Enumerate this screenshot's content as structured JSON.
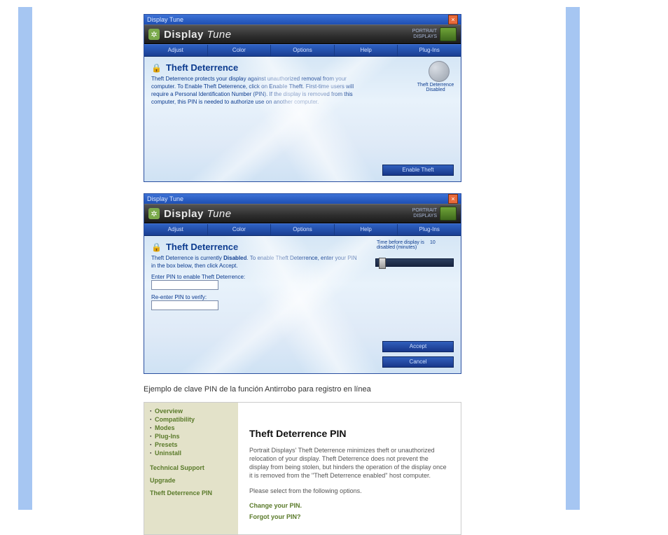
{
  "win1": {
    "titlebar": "Display Tune",
    "brand": {
      "name": "Display",
      "tune": "Tune",
      "right": "PORTRAIT\nDISPLAYS"
    },
    "tabs": [
      "Adjust",
      "Color",
      "Options",
      "Help",
      "Plug-Ins"
    ],
    "heading": "Theft Deterrence",
    "desc_a": "Theft Deterrence protects your display against unauthorized removal from your computer. To Enable Theft Deterrence, click on ",
    "desc_b": "Enable Theft",
    "desc_c": ". First-time users will require a Personal Identification Number (PIN). If the display is removed from this computer, this PIN is needed to authorize use on another computer.",
    "shield_label": "Theft Deterrence Disabled",
    "button": "Enable Theft"
  },
  "win2": {
    "titlebar": "Display Tune",
    "brand": {
      "name": "Display",
      "tune": "Tune",
      "right": "PORTRAIT\nDISPLAYS"
    },
    "tabs": [
      "Adjust",
      "Color",
      "Options",
      "Help",
      "Plug-Ins"
    ],
    "heading": "Theft Deterrence",
    "desc_a": "Theft Deterrence is currently ",
    "desc_b": "Disabled",
    "desc_c": ". To enable Theft Deterrence, enter your PIN in the box below, then click Accept.",
    "pin1_label": "Enter PIN to enable Theft Deterrence:",
    "pin2_label": "Re-enter PIN to verify:",
    "timer_text": "Time before display is disabled (minutes)",
    "timer_value": "10",
    "button_accept": "Accept",
    "button_cancel": "Cancel"
  },
  "caption": "Ejemplo de clave PIN de la función Antirrobo para registro en línea",
  "web": {
    "nav": [
      "Overview",
      "Compatibility",
      "Modes",
      "Plug-Ins",
      "Presets",
      "Uninstall"
    ],
    "links": [
      "Technical Support",
      "Upgrade",
      "Theft Deterrence PIN"
    ],
    "title": "Theft Deterrence PIN",
    "para1": "Portrait Displays' Theft Deterrence minimizes theft or unauthorized relocation of your display. Theft Deterrence does not prevent the display from being stolen, but hinders the operation of the display once it is removed from the \"Theft Deterrence enabled\" host computer.",
    "para2": "Please select from the following options.",
    "link1": "Change your PIN.",
    "link2": "Forgot your PIN?"
  }
}
